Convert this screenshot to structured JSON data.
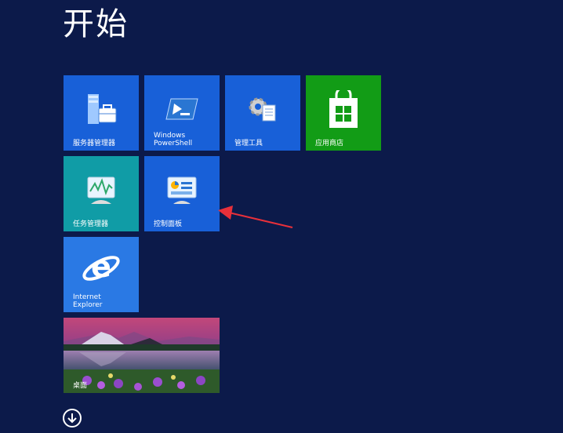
{
  "header": {
    "title": "开始"
  },
  "tiles": [
    {
      "label": "服务器管理器",
      "color": "#1860d8"
    },
    {
      "label": "Windows\nPowerShell",
      "color": "#1860d8"
    },
    {
      "label": "管理工具",
      "color": "#1860d8"
    },
    {
      "label": "应用商店",
      "color": "#129c16"
    },
    {
      "label": "任务管理器",
      "color": "#109ca6"
    },
    {
      "label": "控制面板",
      "color": "#1860d8"
    },
    {
      "label": "Internet\nExplorer",
      "color": "#2a79e4"
    },
    {
      "label": "桌面",
      "color": "#3a1b42"
    }
  ],
  "footer": {
    "down_button_icon": "arrow-down-circle-icon"
  },
  "annotation": {
    "arrow_color": "#e8303a"
  }
}
